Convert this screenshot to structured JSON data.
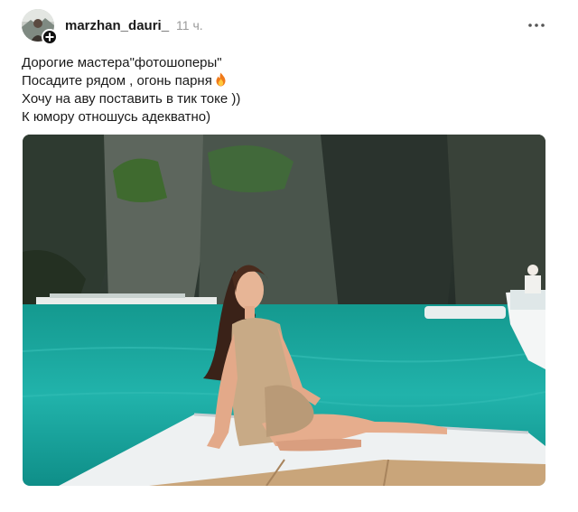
{
  "post": {
    "author": {
      "username": "marzhan_dauri_",
      "avatar_icon": "avatar-image",
      "follow_icon": "plus-icon"
    },
    "time_ago": "11 ч.",
    "more_icon": "more-horizontal-icon",
    "caption": {
      "line1": "Дорогие мастера\"фотошоперы\"",
      "line2": "Посадите рядом , огонь парня",
      "line2_emoji": "fire-emoji",
      "line3": "Хочу на аву поставить в тик токе ))",
      "line4": "К юмору отношусь адекватно)"
    },
    "photo": {
      "type": "image",
      "description_icon": "post-photo"
    }
  },
  "colors": {
    "text": "#1a1a1a",
    "muted": "#9a9a9a",
    "water": "#1fa3a0",
    "cliff": "#2f3a34"
  }
}
